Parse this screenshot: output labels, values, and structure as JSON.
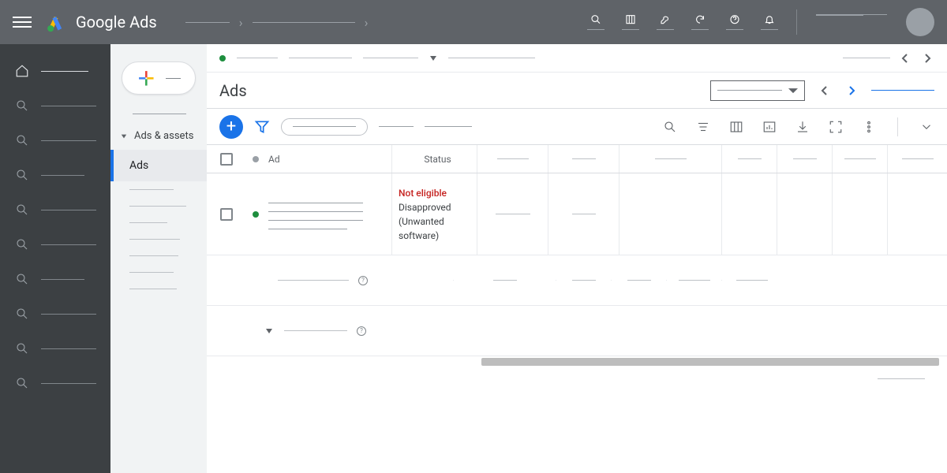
{
  "brand": "Google Ads",
  "nav2": {
    "section_label": "Ads & assets",
    "active_label": "Ads"
  },
  "page": {
    "title": "Ads"
  },
  "table": {
    "col_ad": "Ad",
    "col_status": "Status",
    "row1": {
      "status_error": "Not eligible",
      "status_reason": "Disapproved (Unwanted software)"
    }
  }
}
